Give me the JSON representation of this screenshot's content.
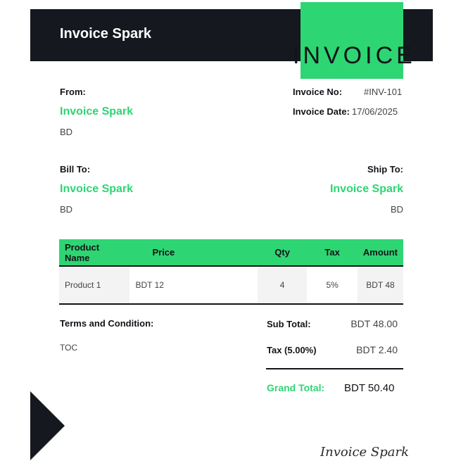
{
  "header": {
    "brand": "Invoice Spark",
    "title": "INVOICE"
  },
  "from": {
    "label": "From:",
    "name": "Invoice Spark",
    "address": "BD"
  },
  "meta": {
    "invoice_no_label": "Invoice No:",
    "invoice_no": "#INV-101",
    "invoice_date_label": "Invoice Date:",
    "invoice_date": "17/06/2025"
  },
  "bill_to": {
    "label": "Bill To:",
    "name": "Invoice Spark",
    "address": "BD"
  },
  "ship_to": {
    "label": "Ship To:",
    "name": "Invoice Spark",
    "address": "BD"
  },
  "table": {
    "headers": [
      "Product Name",
      "Price",
      "Qty",
      "Tax",
      "Amount"
    ],
    "rows": [
      {
        "product": "Product 1",
        "price": "BDT 12",
        "qty": "4",
        "tax": "5%",
        "amount": "BDT 48"
      }
    ]
  },
  "terms": {
    "label": "Terms and Condition:",
    "text": "TOC"
  },
  "totals": {
    "subtotal_label": "Sub Total:",
    "subtotal": "BDT 48.00",
    "tax_label": "Tax (5.00%)",
    "tax": "BDT 2.40",
    "grand_label": "Grand Total:",
    "grand": "BDT 50.40"
  },
  "signature": "Invoice Spark",
  "colors": {
    "accent": "#2ed573",
    "dark": "#15181e"
  }
}
